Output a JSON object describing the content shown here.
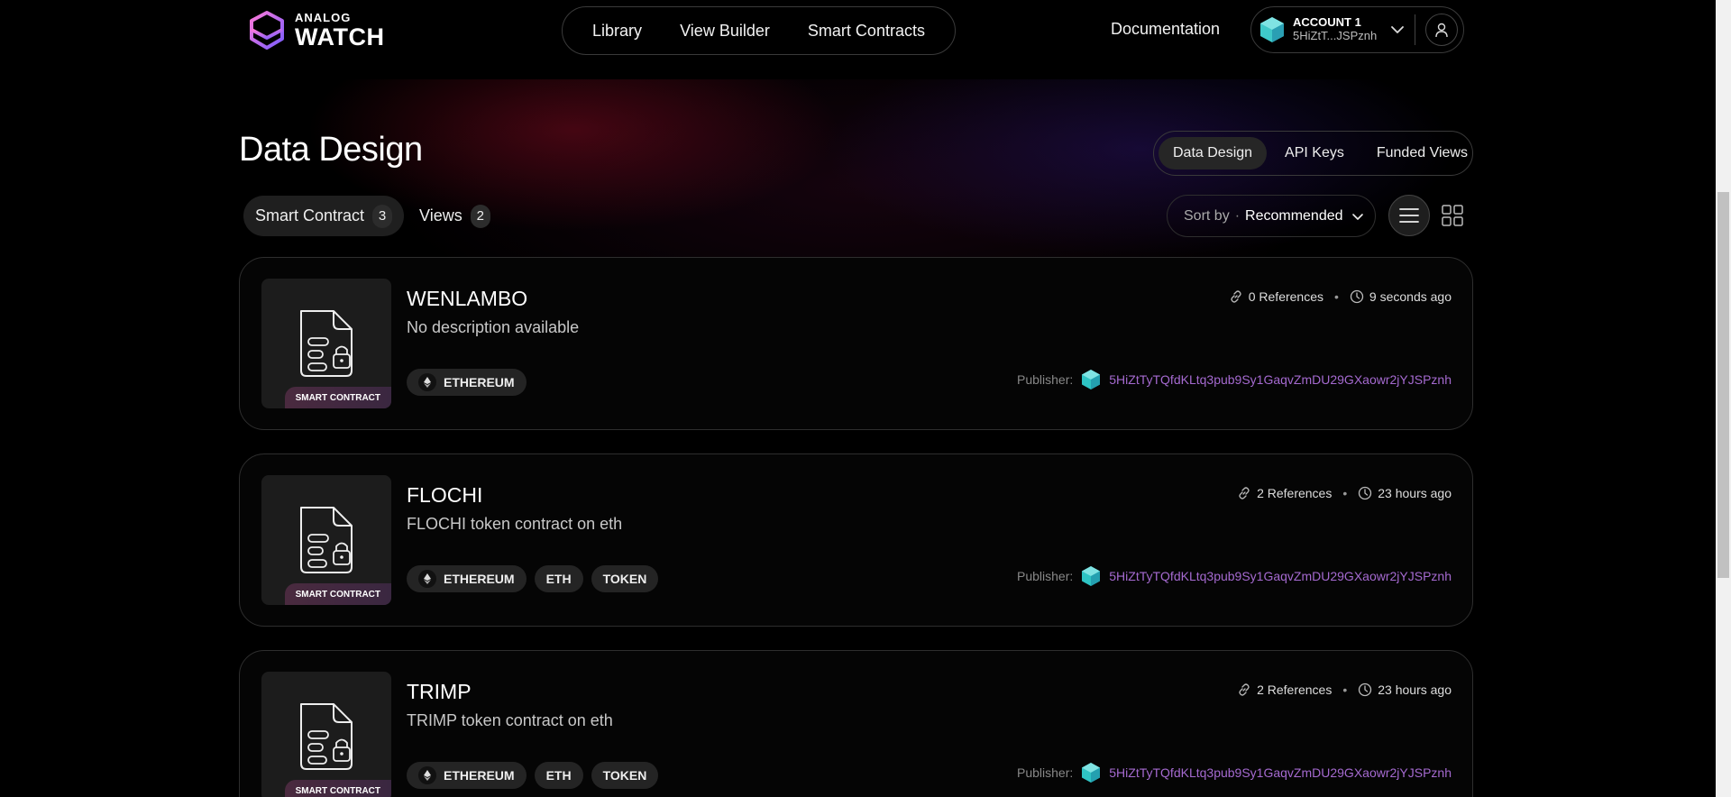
{
  "brand": {
    "small": "ANALOG",
    "big": "WATCH"
  },
  "nav": {
    "items": [
      "Library",
      "View Builder",
      "Smart Contracts"
    ],
    "documentation": "Documentation"
  },
  "account": {
    "name": "ACCOUNT 1",
    "address": "5HiZtT...JSPznh"
  },
  "page": {
    "title": "Data Design"
  },
  "segment": {
    "tabs": [
      "Data Design",
      "API Keys",
      "Funded Views"
    ],
    "active": "Data Design"
  },
  "filters": [
    {
      "label": "Smart Contract",
      "count": "3",
      "active": true
    },
    {
      "label": "Views",
      "count": "2",
      "active": false
    }
  ],
  "sort": {
    "label": "Sort by",
    "value": "Recommended"
  },
  "cards": [
    {
      "title": "WENLAMBO",
      "description": "No description available",
      "badge": "SMART CONTRACT",
      "tags": [
        "ETHEREUM"
      ],
      "references": "0 References",
      "time": "9 seconds ago",
      "publisher_label": "Publisher:",
      "publisher": "5HiZtTyTQfdKLtq3pub9Sy1GaqvZmDU29GXaowr2jYJSPznh"
    },
    {
      "title": "FLOCHI",
      "description": "FLOCHI token contract on eth",
      "badge": "SMART CONTRACT",
      "tags": [
        "ETHEREUM",
        "ETH",
        "TOKEN"
      ],
      "references": "2 References",
      "time": "23 hours ago",
      "publisher_label": "Publisher:",
      "publisher": "5HiZtTyTQfdKLtq3pub9Sy1GaqvZmDU29GXaowr2jYJSPznh"
    },
    {
      "title": "TRIMP",
      "description": "TRIMP token contract on eth",
      "badge": "SMART CONTRACT",
      "tags": [
        "ETHEREUM",
        "ETH",
        "TOKEN"
      ],
      "references": "2 References",
      "time": "23 hours ago",
      "publisher_label": "Publisher:",
      "publisher": "5HiZtTyTQfdKLtq3pub9Sy1GaqvZmDU29GXaowr2jYJSPznh"
    }
  ],
  "colors": {
    "accent": "#a56ad0",
    "background": "#000000",
    "publisher_avatar": "#2ec4c4"
  }
}
